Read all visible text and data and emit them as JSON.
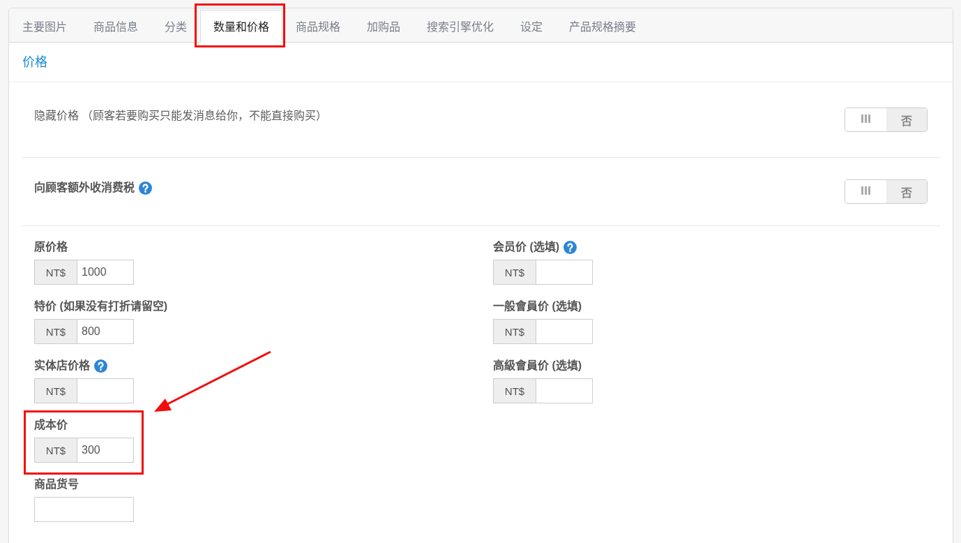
{
  "tabs": [
    {
      "label": "主要图片",
      "selected": false,
      "highlighted": false
    },
    {
      "label": "商品信息",
      "selected": false,
      "highlighted": false
    },
    {
      "label": "分类",
      "selected": false,
      "highlighted": false
    },
    {
      "label": "数量和价格",
      "selected": true,
      "highlighted": true
    },
    {
      "label": "商品规格",
      "selected": false,
      "highlighted": false
    },
    {
      "label": "加购品",
      "selected": false,
      "highlighted": false
    },
    {
      "label": "搜索引擎优化",
      "selected": false,
      "highlighted": false
    },
    {
      "label": "设定",
      "selected": false,
      "highlighted": false
    },
    {
      "label": "产品规格摘要",
      "selected": false,
      "highlighted": false
    }
  ],
  "section": {
    "title": "价格"
  },
  "settings": [
    {
      "kind": "plain",
      "label": "隐藏价格 （顾客若要购买只能发消息给你，不能直接购买）",
      "help": false,
      "on": false,
      "off_label": "否"
    },
    {
      "kind": "strong",
      "label": "向顾客额外收消费税",
      "help": true,
      "on": false,
      "off_label": "否"
    }
  ],
  "columns": [
    {
      "fields": [
        {
          "kind": "currency",
          "label": "原价格",
          "help": false,
          "prefix": "NT$",
          "value": "1000",
          "highlighted": false
        },
        {
          "kind": "currency",
          "label": "特价 (如果没有打折请留空)",
          "help": false,
          "prefix": "NT$",
          "value": "800",
          "highlighted": false
        },
        {
          "kind": "currency",
          "label": "实体店价格",
          "help": true,
          "prefix": "NT$",
          "highlighted": false
        },
        {
          "kind": "currency",
          "label": "成本价",
          "help": false,
          "prefix": "NT$",
          "value": "300",
          "highlighted": true
        },
        {
          "kind": "plain",
          "label": "商品货号",
          "help": false,
          "highlighted": false
        }
      ]
    },
    {
      "fields": [
        {
          "kind": "currency",
          "label": "会员价 (选填)",
          "help": true,
          "prefix": "NT$",
          "highlighted": false
        },
        {
          "kind": "currency",
          "label": "一般會員价 (选填)",
          "help": false,
          "prefix": "NT$",
          "highlighted": false
        },
        {
          "kind": "currency",
          "label": "高級會員价 (选填)",
          "help": false,
          "prefix": "NT$",
          "highlighted": false
        }
      ]
    }
  ]
}
